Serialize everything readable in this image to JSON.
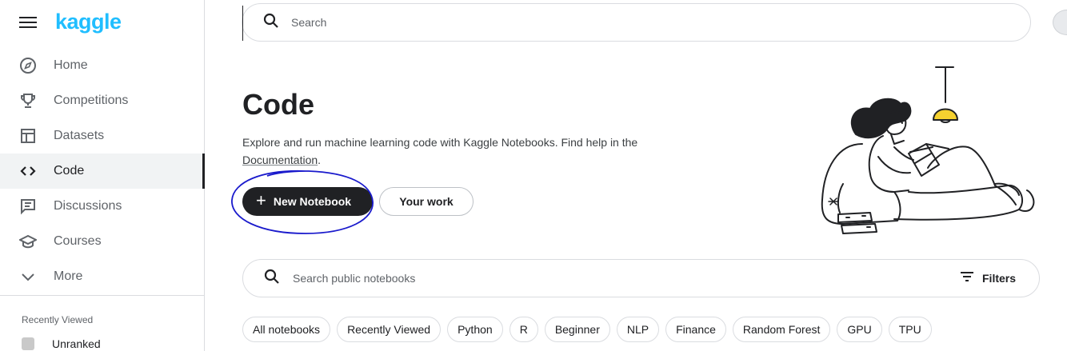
{
  "brand": {
    "logo_text": "kaggle",
    "color": "#20beff"
  },
  "sidebar": {
    "items": [
      {
        "label": "Home",
        "icon": "compass-icon",
        "active": false
      },
      {
        "label": "Competitions",
        "icon": "trophy-icon",
        "active": false
      },
      {
        "label": "Datasets",
        "icon": "table-icon",
        "active": false
      },
      {
        "label": "Code",
        "icon": "code-brackets-icon",
        "active": true
      },
      {
        "label": "Discussions",
        "icon": "message-icon",
        "active": false
      },
      {
        "label": "Courses",
        "icon": "graduation-cap-icon",
        "active": false
      },
      {
        "label": "More",
        "icon": "chevron-down-icon",
        "active": false
      }
    ],
    "recently_viewed": {
      "title": "Recently Viewed",
      "items": [
        {
          "label": "Unranked"
        }
      ]
    }
  },
  "header": {
    "search_placeholder": "Search"
  },
  "hero": {
    "title": "Code",
    "description_before": "Explore and run machine learning code with Kaggle Notebooks. Find help in the ",
    "doc_link": "Documentation",
    "description_after": ".",
    "new_notebook_label": "New Notebook",
    "your_work_label": "Your work",
    "annotation_color": "#1a1acc"
  },
  "notebook_search": {
    "placeholder": "Search public notebooks",
    "filters_label": "Filters"
  },
  "chips": [
    "All notebooks",
    "Recently Viewed",
    "Python",
    "R",
    "Beginner",
    "NLP",
    "Finance",
    "Random Forest",
    "GPU",
    "TPU"
  ]
}
